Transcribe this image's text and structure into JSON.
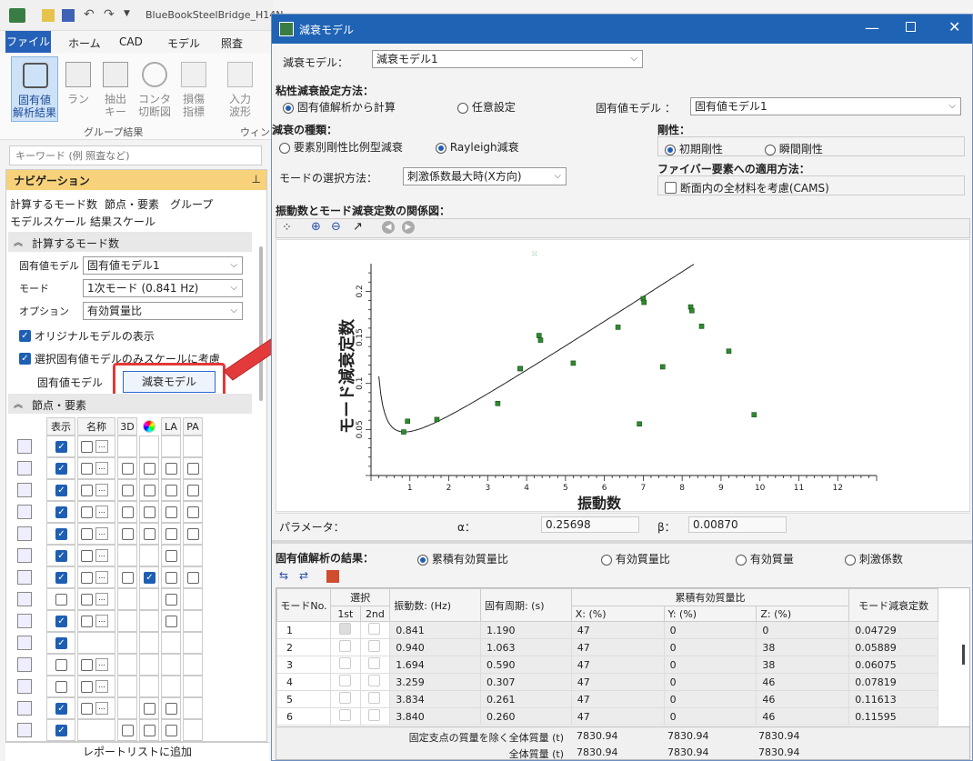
{
  "app": {
    "title": "BlueBookSteelBridge_H14N...",
    "menu_tabs": [
      "ファイル",
      "ホーム",
      "CAD",
      "モデル",
      "照査"
    ],
    "ribbon_buttons": [
      {
        "label": "固有値\n解析結果",
        "icon": "mode-shape-icon"
      },
      {
        "label": "ラン",
        "icon": "wave-icon"
      },
      {
        "label": "抽出\nキー",
        "icon": "wave-icon"
      },
      {
        "label": "コンタ\n切断図",
        "icon": "contour-icon"
      },
      {
        "label": "損傷\n指標",
        "icon": "damage-icon"
      },
      {
        "label": "入力\n波形",
        "icon": "waveform-icon"
      }
    ],
    "ribbon_group": "グループ結果",
    "ribbon_group2": "ウィン",
    "keyword_placeholder": "キーワード (例 照査など)",
    "footer_button": "レポートリストに追加"
  },
  "nav": {
    "title": "ナビゲーション",
    "links_row1": [
      "計算するモード数",
      "節点・要素",
      "グループ"
    ],
    "links_row2": [
      "モデルスケール",
      "結果スケール"
    ],
    "section1": "計算するモード数",
    "fields": [
      {
        "label": "固有値モデル",
        "value": "固有値モデル1"
      },
      {
        "label": "モード",
        "value": "1次モード (0.841 Hz)"
      },
      {
        "label": "オプション",
        "value": "有効質量比"
      }
    ],
    "checks": [
      {
        "label": "オリジナルモデルの表示",
        "checked": true
      },
      {
        "label": "選択固有値モデルのみスケールに考慮",
        "checked": true
      }
    ],
    "btn_eigen": "固有値モデル",
    "btn_damping": "減衰モデル",
    "section2": "節点・要素",
    "grid_headers": [
      "表示",
      "名称",
      "3D",
      "",
      "LA",
      "PA"
    ],
    "grid_rows": [
      {
        "icon": "node-icon",
        "cells": [
          1,
          "c",
          null,
          null,
          null,
          null
        ]
      },
      {
        "icon": "beam-icon",
        "cells": [
          1,
          "c",
          0,
          0,
          0,
          0
        ]
      },
      {
        "icon": "shell-icon",
        "cells": [
          1,
          "c",
          0,
          0,
          0,
          0
        ]
      },
      {
        "icon": "spring-icon",
        "cells": [
          1,
          "c",
          0,
          0,
          0,
          0
        ]
      },
      {
        "icon": "link-icon",
        "cells": [
          1,
          "c",
          0,
          0,
          0,
          0
        ]
      },
      {
        "icon": "rigid-icon",
        "cells": [
          1,
          "c",
          null,
          null,
          0,
          null
        ]
      },
      {
        "icon": "solid-icon",
        "cells": [
          1,
          "c",
          0,
          1,
          0,
          0
        ]
      },
      {
        "icon": "mass-icon",
        "cells": [
          0,
          "c",
          null,
          null,
          0,
          null
        ]
      },
      {
        "icon": "support-icon",
        "cells": [
          1,
          "c",
          null,
          null,
          0,
          null
        ]
      },
      {
        "icon": "hatch-icon",
        "cells": [
          1,
          null,
          null,
          null,
          null,
          null
        ]
      },
      {
        "icon": "axis-icon",
        "cells": [
          0,
          "c",
          null,
          null,
          null,
          null
        ]
      },
      {
        "icon": "damper-icon",
        "cells": [
          0,
          "c",
          null,
          null,
          null,
          null
        ]
      },
      {
        "icon": "moment-icon",
        "cells": [
          1,
          "c",
          null,
          0,
          0,
          null
        ]
      },
      {
        "icon": "cross-icon",
        "cells": [
          1,
          null,
          0,
          0,
          0,
          null
        ]
      }
    ]
  },
  "dialog": {
    "title": "減衰モデル",
    "model_label": "減衰モデル：",
    "model_value": "減衰モデル1",
    "viscous_label": "粘性減衰設定方法：",
    "viscous_opts": [
      "固有値解析から計算",
      "任意設定"
    ],
    "eigen_label": "固有値モデル ：",
    "eigen_value": "固有値モデル1",
    "kind_label": "減衰の種類：",
    "kind_opts": [
      "要素別剛性比例型減衰",
      "Rayleigh減衰"
    ],
    "stiff_label": "剛性：",
    "stiff_opts": [
      "初期剛性",
      "瞬間剛性"
    ],
    "mode_sel_label": "モードの選択方法：",
    "mode_sel_value": "刺激係数最大時(X方向)",
    "fiber_label": "ファイバー要素への適用方法：",
    "fiber_check": "断面内の全材料を考慮(CAMS)",
    "chart_title": "振動数とモード減衰定数の関係図：",
    "param_label": "パラメータ：",
    "alpha_label": "α：",
    "alpha_value": "0.25698",
    "beta_label": "β：",
    "beta_value": "0.00870",
    "results_label": "固有値解析の結果：",
    "result_opts": [
      "累積有効質量比",
      "有効質量比",
      "有効質量",
      "刺激係数"
    ],
    "table": {
      "h_mode": "モードNo.",
      "h_select": "選択",
      "h_1st": "1st",
      "h_2nd": "2nd",
      "h_freq": "振動数: (Hz)",
      "h_period": "固有周期: (s)",
      "h_cum": "累積有効質量比",
      "h_x": "X: (%)",
      "h_y": "Y: (%)",
      "h_z": "Z: (%)",
      "h_damp": "モード減衰定数",
      "rows": [
        [
          "1",
          "0.841",
          "1.190",
          "47",
          "0",
          "0",
          "0.04729"
        ],
        [
          "2",
          "0.940",
          "1.063",
          "47",
          "0",
          "38",
          "0.05889"
        ],
        [
          "3",
          "1.694",
          "0.590",
          "47",
          "0",
          "38",
          "0.06075"
        ],
        [
          "4",
          "3.259",
          "0.307",
          "47",
          "0",
          "46",
          "0.07819"
        ],
        [
          "5",
          "3.834",
          "0.261",
          "47",
          "0",
          "46",
          "0.11613"
        ],
        [
          "6",
          "3.840",
          "0.260",
          "47",
          "0",
          "46",
          "0.11595"
        ]
      ],
      "foot1_label": "固定支点の質量を除く全体質量 (t)",
      "foot1": [
        "7830.94",
        "7830.94",
        "7830.94"
      ],
      "foot2_label": "全体質量 (t)",
      "foot2": [
        "7830.94",
        "7830.94",
        "7830.94"
      ]
    }
  },
  "chart_data": {
    "type": "scatter",
    "xlabel": "振動数",
    "ylabel": "モード減衰定数",
    "xlim": [
      0,
      13
    ],
    "ylim": [
      0,
      0.23
    ],
    "xticks": [
      1,
      2,
      3,
      4,
      5,
      6,
      7,
      8,
      9,
      10,
      11,
      12
    ],
    "yticks": [
      0.05,
      0.1,
      0.15,
      0.2
    ],
    "points": [
      [
        0.841,
        0.0473
      ],
      [
        0.94,
        0.0589
      ],
      [
        1.694,
        0.0608
      ],
      [
        3.259,
        0.0782
      ],
      [
        3.834,
        0.1161
      ],
      [
        3.84,
        0.116
      ],
      [
        4.32,
        0.152
      ],
      [
        4.36,
        0.147
      ],
      [
        5.2,
        0.122
      ],
      [
        6.35,
        0.161
      ],
      [
        6.9,
        0.056
      ],
      [
        7.0,
        0.192
      ],
      [
        7.02,
        0.188
      ],
      [
        7.5,
        0.118
      ],
      [
        8.22,
        0.183
      ],
      [
        8.25,
        0.179
      ],
      [
        8.5,
        0.162
      ],
      [
        9.2,
        0.135
      ],
      [
        9.85,
        0.066
      ]
    ],
    "curve": {
      "alpha": 0.25698,
      "beta": 0.0087,
      "xmin": 0.2,
      "xmax": 8.8
    }
  }
}
